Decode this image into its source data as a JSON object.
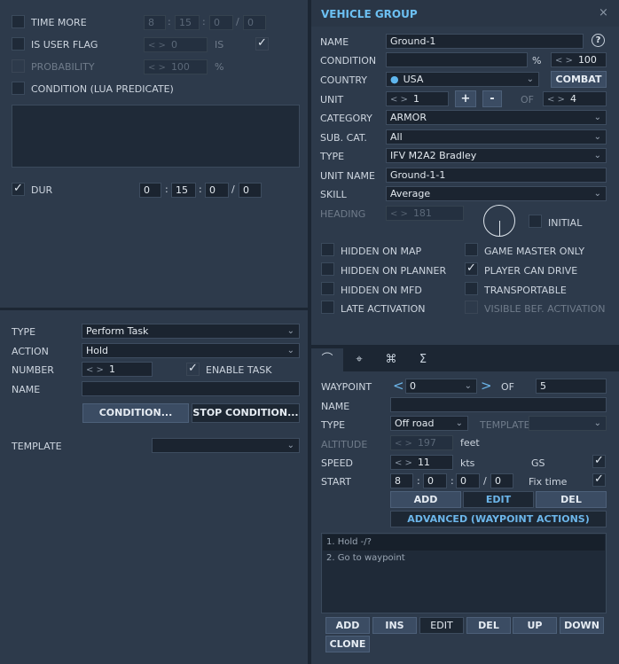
{
  "left": {
    "time_more": {
      "label": "TIME MORE",
      "d": "8",
      "h": "15",
      "m": "0",
      "s": "0"
    },
    "user_flag": {
      "label": "IS USER FLAG",
      "value": "0",
      "is_label": "IS"
    },
    "probability": {
      "label": "PROBABILITY",
      "value": "100",
      "unit": "%"
    },
    "condition_lua": {
      "label": "CONDITION (LUA PREDICATE)"
    },
    "dur": {
      "label": "DUR",
      "d": "0",
      "h": "15",
      "m": "0",
      "s": "0"
    },
    "type": {
      "label": "TYPE",
      "value": "Perform Task"
    },
    "action": {
      "label": "ACTION",
      "value": "Hold"
    },
    "number": {
      "label": "NUMBER",
      "value": "1",
      "enable_task": "ENABLE TASK"
    },
    "name": {
      "label": "NAME",
      "value": ""
    },
    "condition_button": "CONDITION...",
    "stop_condition_button": "STOP CONDITION...",
    "template": {
      "label": "TEMPLATE",
      "value": ""
    }
  },
  "vehicle_group": {
    "title": "VEHICLE GROUP",
    "close": "×",
    "help": "?",
    "name": {
      "label": "NAME",
      "value": "Ground-1"
    },
    "condition": {
      "label": "CONDITION",
      "value": "",
      "unit": "%",
      "percent": "100"
    },
    "country": {
      "label": "COUNTRY",
      "value": "USA",
      "combat": "COMBAT"
    },
    "unit": {
      "label": "UNIT",
      "value": "1",
      "plus": "+",
      "minus": "-",
      "of": "OF",
      "total": "4"
    },
    "category": {
      "label": "CATEGORY",
      "value": "ARMOR"
    },
    "subcat": {
      "label": "SUB. CAT.",
      "value": "All"
    },
    "type": {
      "label": "TYPE",
      "value": "IFV M2A2 Bradley"
    },
    "unit_name": {
      "label": "UNIT NAME",
      "value": "Ground-1-1"
    },
    "skill": {
      "label": "SKILL",
      "value": "Average"
    },
    "heading": {
      "label": "HEADING",
      "value": "181",
      "initial": "INITIAL"
    },
    "checks": [
      {
        "label": "HIDDEN ON MAP",
        "checked": false,
        "dim": false
      },
      {
        "label": "GAME MASTER ONLY",
        "checked": false,
        "dim": false
      },
      {
        "label": "HIDDEN ON PLANNER",
        "checked": false,
        "dim": false
      },
      {
        "label": "PLAYER CAN DRIVE",
        "checked": true,
        "dim": false
      },
      {
        "label": "HIDDEN ON MFD",
        "checked": false,
        "dim": false
      },
      {
        "label": "TRANSPORTABLE",
        "checked": false,
        "dim": false
      },
      {
        "label": "LATE ACTIVATION",
        "checked": false,
        "dim": false
      },
      {
        "label": "VISIBLE BEF. ACTIVATION",
        "checked": false,
        "dim": true
      }
    ]
  },
  "tabs": [
    {
      "icon": "route-icon",
      "glyph": "⌒"
    },
    {
      "icon": "target-icon",
      "glyph": "⌖"
    },
    {
      "icon": "link-icon",
      "glyph": "⌘"
    },
    {
      "icon": "sigma-icon",
      "glyph": "Σ"
    }
  ],
  "waypoint": {
    "label": "WAYPOINT",
    "value": "0",
    "prev": "<",
    "next": ">",
    "of": "OF",
    "total": "5",
    "name": {
      "label": "NAME",
      "value": ""
    },
    "type": {
      "label": "TYPE",
      "value": "Off road",
      "template": "TEMPLATE"
    },
    "altitude": {
      "label": "ALTITUDE",
      "value": "197",
      "unit": "feet"
    },
    "speed": {
      "label": "SPEED",
      "value": "11",
      "unit": "kts",
      "gs": "GS"
    },
    "start": {
      "label": "START",
      "d": "8",
      "h": "0",
      "m": "0",
      "s": "0",
      "fix_time": "Fix time"
    },
    "add": "ADD",
    "edit": "EDIT",
    "del": "DEL",
    "advanced": "ADVANCED (WAYPOINT ACTIONS)"
  },
  "actions_list": [
    "1. Hold -/?",
    "2. Go to waypoint"
  ],
  "bottom_buttons": {
    "add": "ADD",
    "ins": "INS",
    "edit": "EDIT",
    "del": "DEL",
    "up": "UP",
    "down": "DOWN",
    "clone": "CLONE"
  }
}
